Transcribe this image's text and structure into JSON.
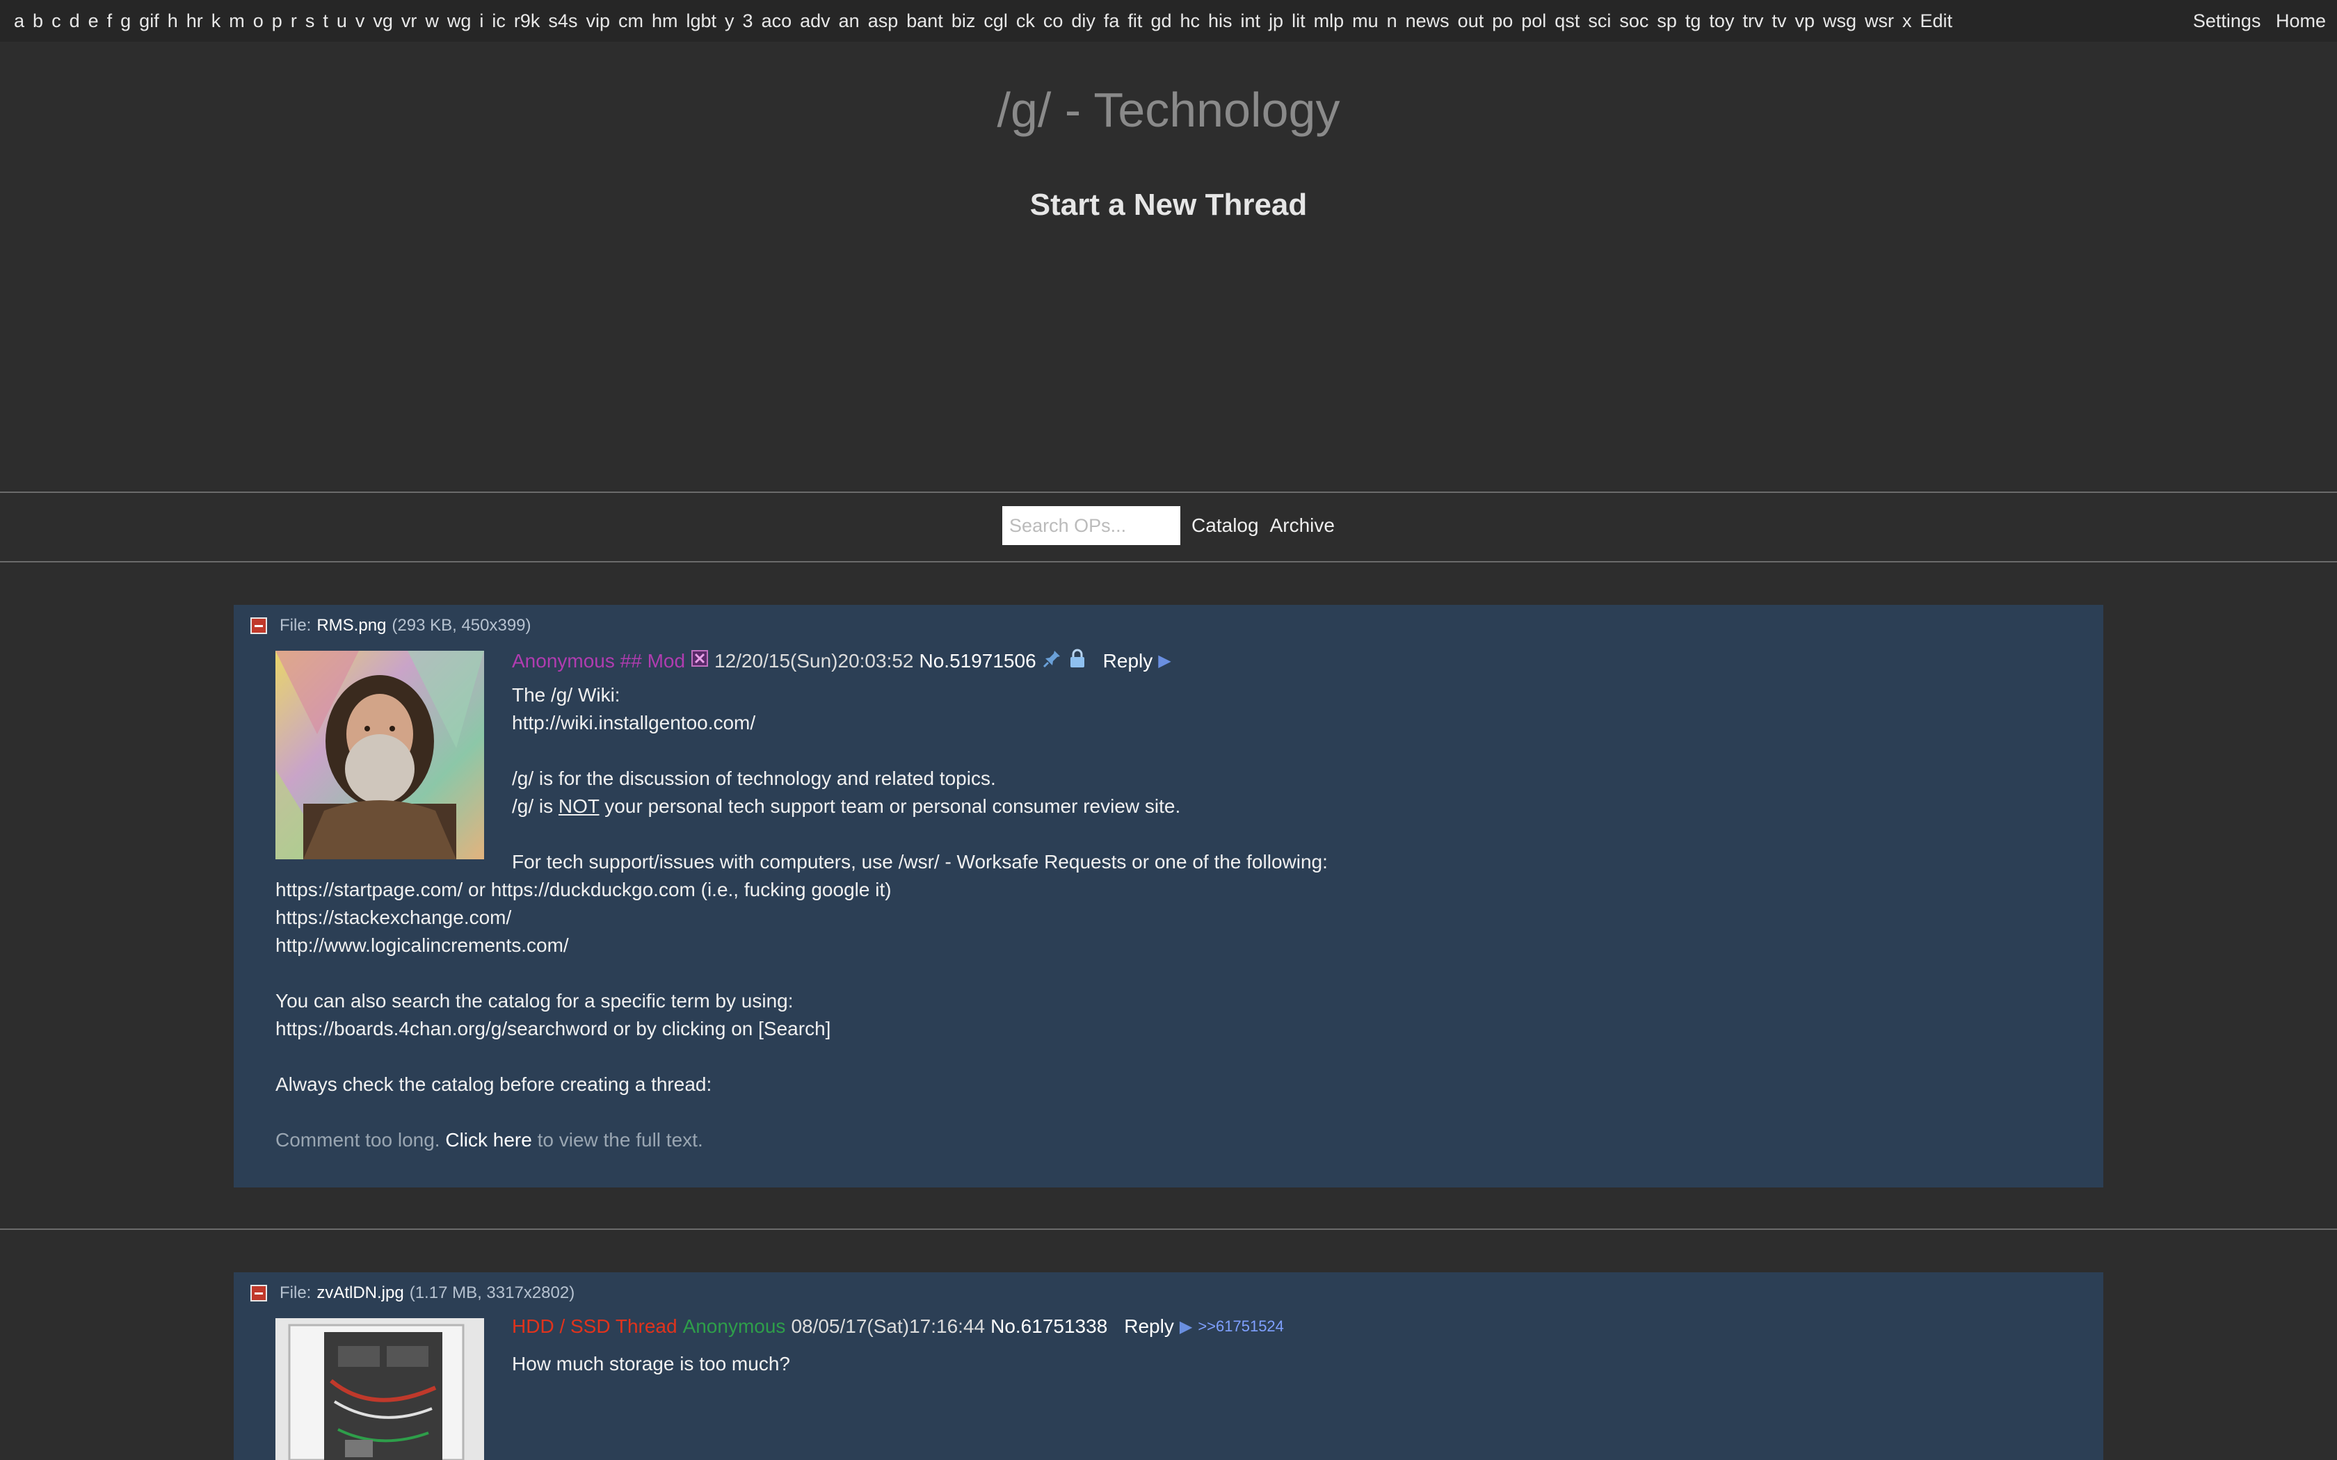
{
  "topnav": {
    "boards": [
      "a",
      "b",
      "c",
      "d",
      "e",
      "f",
      "g",
      "gif",
      "h",
      "hr",
      "k",
      "m",
      "o",
      "p",
      "r",
      "s",
      "t",
      "u",
      "v",
      "vg",
      "vr",
      "w",
      "wg",
      "i",
      "ic",
      "r9k",
      "s4s",
      "vip",
      "cm",
      "hm",
      "lgbt",
      "y",
      "3",
      "aco",
      "adv",
      "an",
      "asp",
      "bant",
      "biz",
      "cgl",
      "ck",
      "co",
      "diy",
      "fa",
      "fit",
      "gd",
      "hc",
      "his",
      "int",
      "jp",
      "lit",
      "mlp",
      "mu",
      "n",
      "news",
      "out",
      "po",
      "pol",
      "qst",
      "sci",
      "soc",
      "sp",
      "tg",
      "toy",
      "trv",
      "tv",
      "vp",
      "wsg",
      "wsr",
      "x",
      "Edit"
    ],
    "settings": "Settings",
    "home": "Home"
  },
  "board_title": "/g/ - Technology",
  "new_thread": "Start a New Thread",
  "search": {
    "placeholder": "Search OPs...",
    "catalog": "Catalog",
    "archive": "Archive"
  },
  "thread1": {
    "file_label": "File:",
    "file_name": "RMS.png",
    "file_meta": "(293 KB, 450x399)",
    "name": "Anonymous ## Mod",
    "date": "12/20/15(Sun)20:03:52",
    "number": "No.51971506",
    "reply": "Reply",
    "lines": {
      "l1": "The /g/ Wiki:",
      "l2": "http://wiki.installgentoo.com/",
      "l3": "/g/ is for the discussion of technology and related topics.",
      "l4a": "/g/ is ",
      "l4b": "NOT",
      "l4c": " your personal tech support team or personal consumer review site.",
      "l5": "For tech support/issues with computers, use /wsr/ - Worksafe Requests or one of the following:",
      "l6": "https://startpage.com/ or https://duckduckgo.com (i.e., fucking google it)",
      "l7": "https://stackexchange.com/",
      "l8": "http://www.logicalincrements.com/",
      "l9": "You can also search the catalog for a specific term by using:",
      "l10": "https://boards.4chan.org/g/searchword or by clicking on [Search]",
      "l11": "Always check the catalog before creating a thread:",
      "trunc_a": "Comment too long. ",
      "trunc_b": "Click here",
      "trunc_c": " to view the full text."
    }
  },
  "thread2": {
    "file_label": "File:",
    "file_name": "zvAtlDN.jpg",
    "file_meta": "(1.17 MB, 3317x2802)",
    "subject": "HDD / SSD Thread",
    "name": "Anonymous",
    "date": "08/05/17(Sat)17:16:44",
    "number": "No.61751338",
    "reply": "Reply",
    "backlink": ">>61751524",
    "body": "How much storage is too much?"
  },
  "colors": {
    "background": "#2d2d2d",
    "post_bg": "#2c3f55",
    "mod_name": "#b03cb0",
    "anon_name": "#2e9e4a",
    "subject": "#e0331c"
  },
  "icons": [
    "minus-icon",
    "mod-capcode-icon",
    "sticky-pin-icon",
    "lock-icon",
    "arrow-icon"
  ]
}
